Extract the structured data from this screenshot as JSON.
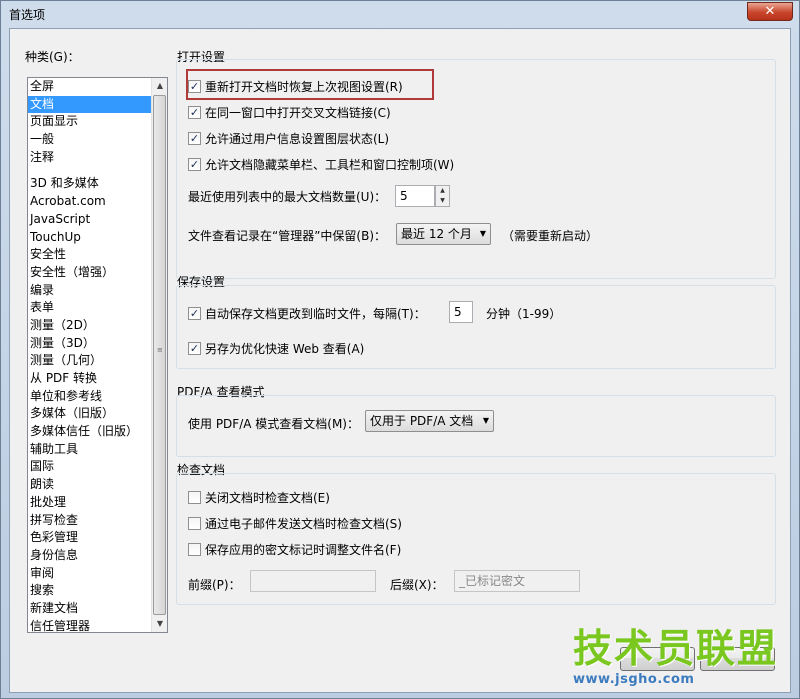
{
  "window": {
    "title": "首选项",
    "close_glyph": "✕"
  },
  "categories": {
    "label": "种类(G)：",
    "group1": [
      "全屏",
      "文档",
      "页面显示",
      "一般",
      "注释"
    ],
    "group2": [
      "3D 和多媒体",
      "Acrobat.com",
      "JavaScript",
      "TouchUp",
      "安全性",
      "安全性（增强）",
      "编录",
      "表单",
      "测量（2D）",
      "测量（3D）",
      "测量（几何）",
      "从 PDF 转换",
      "单位和参考线",
      "多媒体（旧版）",
      "多媒体信任（旧版）",
      "辅助工具",
      "国际",
      "朗读",
      "批处理",
      "拼写检查",
      "色彩管理",
      "身份信息",
      "审阅",
      "搜索",
      "新建文档",
      "信任管理器"
    ],
    "selected": "文档"
  },
  "open_settings": {
    "title": "打开设置",
    "options": [
      {
        "label": "重新打开文档时恢复上次视图设置(R)",
        "checked": true
      },
      {
        "label": "在同一窗口中打开交叉文档链接(C)",
        "checked": true
      },
      {
        "label": "允许通过用户信息设置图层状态(L)",
        "checked": true
      },
      {
        "label": "允许文档隐藏菜单栏、工具栏和窗口控制项(W)",
        "checked": true
      }
    ],
    "recent_label": "最近使用列表中的最大文档数量(U)：",
    "recent_value": "5",
    "history_label": "文件查看记录在“管理器”中保留(B)：",
    "history_value": "最近 12 个月",
    "history_note": "（需要重新启动）"
  },
  "save_settings": {
    "title": "保存设置",
    "autosave_label": "自动保存文档更改到临时文件，每隔(T)：",
    "autosave_checked": true,
    "autosave_value": "5",
    "autosave_unit": "分钟（1-99）",
    "optimize_label": "另存为优化快速 Web 查看(A)",
    "optimize_checked": true
  },
  "pdfa": {
    "title": "PDF/A 查看模式",
    "label": "使用 PDF/A 模式查看文档(M)：",
    "value": "仅用于 PDF/A 文档"
  },
  "inspect": {
    "title": "检查文档",
    "options": [
      {
        "label": "关闭文档时检查文档(E)",
        "checked": false
      },
      {
        "label": "通过电子邮件发送文档时检查文档(S)",
        "checked": false
      },
      {
        "label": "保存应用的密文标记时调整文件名(F)",
        "checked": false
      }
    ],
    "prefix_label": "前缀(P)：",
    "prefix_value": "",
    "suffix_label": "后缀(X)：",
    "suffix_value": "_已标记密文"
  },
  "watermark": {
    "logo": "技术员联盟",
    "url": "www.jsgho.com"
  },
  "icons": {
    "check": "✓",
    "up": "▲",
    "down": "▼"
  }
}
